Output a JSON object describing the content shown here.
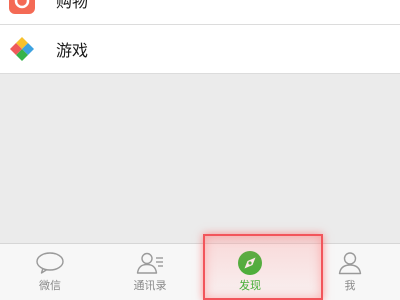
{
  "list": {
    "items": [
      {
        "label": "购物",
        "icon": "shopping-icon",
        "color": "#f46a55"
      },
      {
        "label": "游戏",
        "icon": "game-icon",
        "color": "#f7c12d"
      }
    ]
  },
  "tabbar": {
    "tabs": [
      {
        "label": "微信",
        "icon": "chat-bubble-icon",
        "active": false
      },
      {
        "label": "通讯录",
        "icon": "contacts-icon",
        "active": false
      },
      {
        "label": "发现",
        "icon": "compass-icon",
        "active": true
      },
      {
        "label": "我",
        "icon": "person-icon",
        "active": false
      }
    ],
    "active_color": "#1aad19",
    "inactive_color": "#8a8a8a"
  },
  "highlight": {
    "color": "#f2555b"
  }
}
